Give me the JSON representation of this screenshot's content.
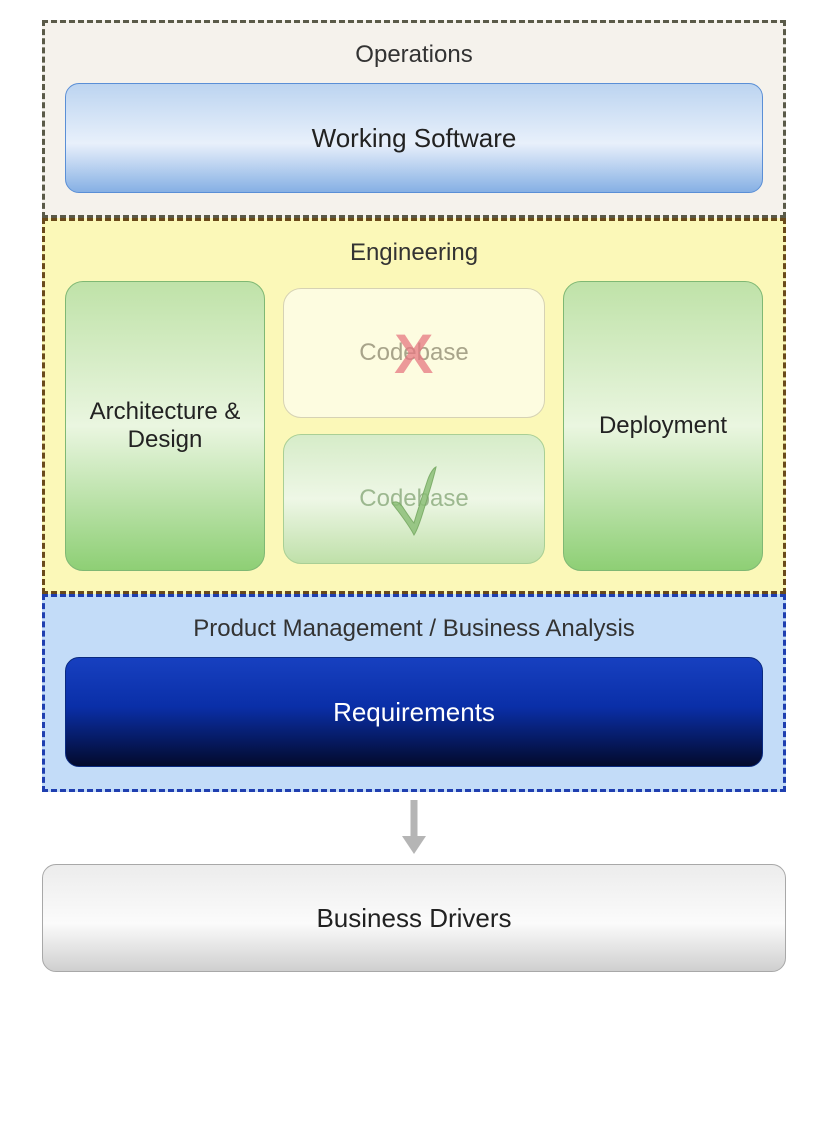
{
  "operations": {
    "title": "Operations",
    "box": "Working Software"
  },
  "engineering": {
    "title": "Engineering",
    "left": "Architecture & Design",
    "codebase_fail": "Codebase",
    "codebase_pass": "Codebase",
    "right": "Deployment"
  },
  "pm": {
    "title": "Product Management / Business Analysis",
    "box": "Requirements"
  },
  "business_drivers": "Business Drivers"
}
